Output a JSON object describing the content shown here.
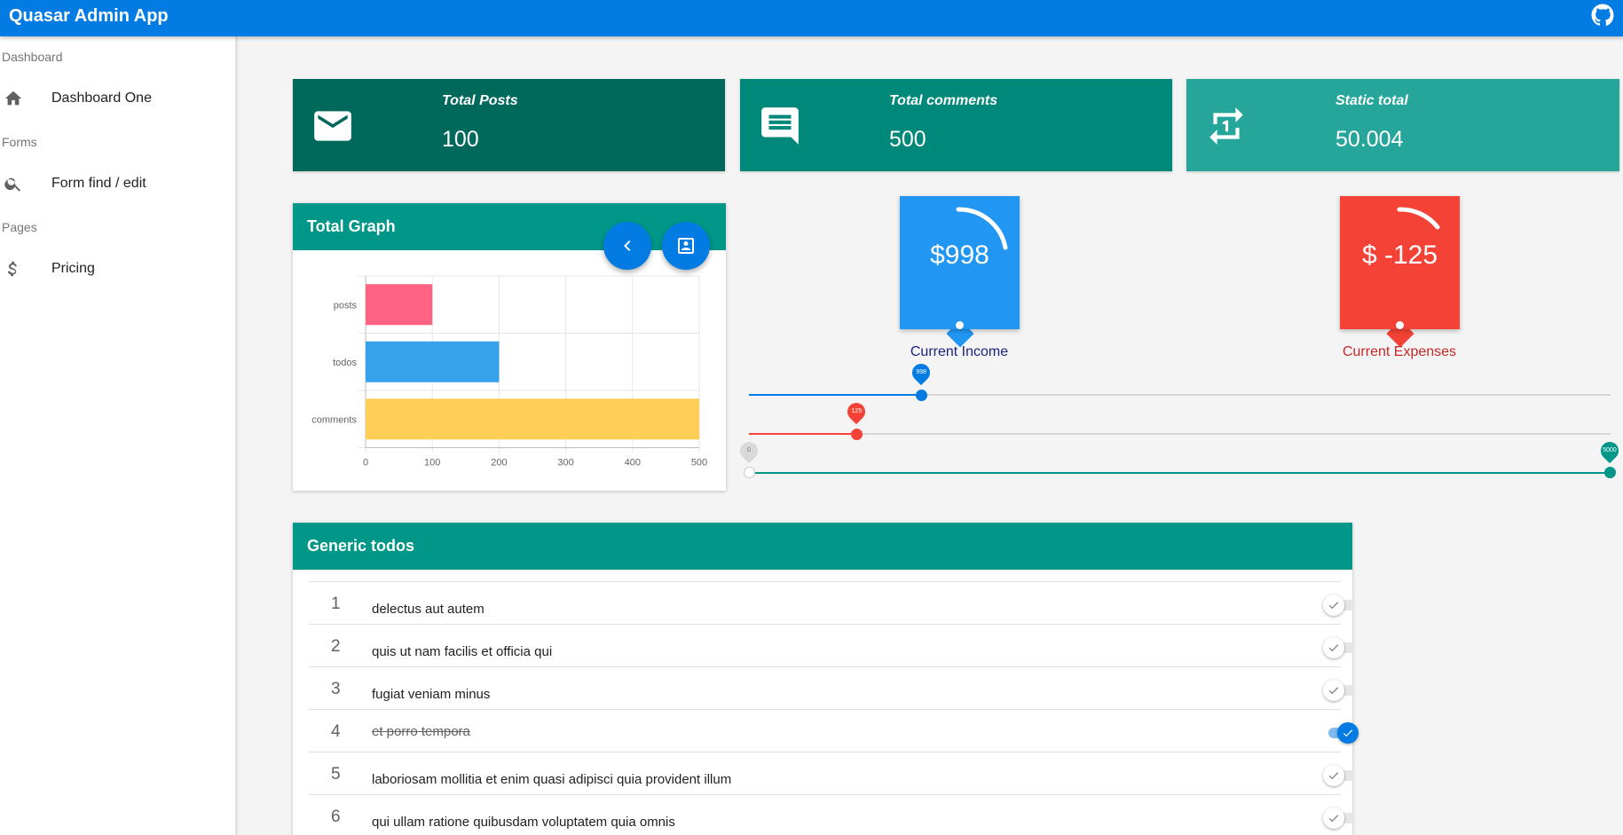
{
  "app": {
    "title": "Quasar Admin App",
    "github_icon": "github-icon"
  },
  "sidebar": {
    "sections": [
      {
        "header": "Dashboard",
        "items": [
          {
            "label": "Dashboard One",
            "icon": "home-icon"
          }
        ]
      },
      {
        "header": "Forms",
        "items": [
          {
            "label": "Form find / edit",
            "icon": "search-icon"
          }
        ]
      },
      {
        "header": "Pages",
        "items": [
          {
            "label": "Pricing",
            "icon": "dollar-icon"
          }
        ]
      }
    ]
  },
  "stats": [
    {
      "label": "Total Posts",
      "value": "100",
      "icon": "mail-icon",
      "color": "#00695c"
    },
    {
      "label": "Total comments",
      "value": "500",
      "icon": "comment-icon",
      "color": "#00897b"
    },
    {
      "label": "Static total",
      "value": "50.004",
      "icon": "repeat-one-icon",
      "color": "#26a69a"
    }
  ],
  "graph_card": {
    "title": "Total Graph",
    "fab_back_icon": "chevron-left-icon",
    "fab_contact_icon": "contact-card-icon"
  },
  "chart_data": {
    "type": "bar",
    "orientation": "horizontal",
    "categories": [
      "posts",
      "todos",
      "comments"
    ],
    "values": [
      100,
      200,
      500
    ],
    "colors": [
      "#ff6384",
      "#36a2eb",
      "#ffce56"
    ],
    "xlim": [
      0,
      500
    ],
    "xticks": [
      "0",
      "100",
      "200",
      "300",
      "400",
      "500"
    ],
    "grid": true
  },
  "knobs": [
    {
      "value": "$998",
      "label": "Current Income",
      "color": "#2196f3",
      "label_color": "#1a237e"
    },
    {
      "value": "$ -125",
      "label": "Current Expenses",
      "color": "#f44336",
      "label_color": "#c62828"
    }
  ],
  "sliders": [
    {
      "pin": "998",
      "fraction": 0.2,
      "color": "#027be3"
    },
    {
      "pin": "125",
      "fraction": 0.125,
      "color": "#f44336"
    },
    {
      "pin_min": "0",
      "pin_max": "5000",
      "color": "#009688"
    }
  ],
  "todos_card": {
    "title": "Generic todos",
    "items": [
      {
        "num": "1",
        "text": "delectus aut autem",
        "done": false
      },
      {
        "num": "2",
        "text": "quis ut nam facilis et officia qui",
        "done": false
      },
      {
        "num": "3",
        "text": "fugiat veniam minus",
        "done": false
      },
      {
        "num": "4",
        "text": "et porro tempora",
        "done": true
      },
      {
        "num": "5",
        "text": "laboriosam mollitia et enim quasi adipisci quia provident illum",
        "done": false
      },
      {
        "num": "6",
        "text": "qui ullam ratione quibusdam voluptatem quia omnis",
        "done": false
      }
    ]
  }
}
